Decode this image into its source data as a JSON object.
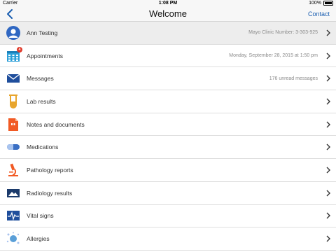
{
  "status_bar": {
    "carrier": "Carrier",
    "time": "1:08 PM",
    "battery": "100%"
  },
  "nav": {
    "title": "Welcome",
    "contact_label": "Contact"
  },
  "profile": {
    "name": "Ann Testing",
    "detail": "Mayo Clinic Number:  3-303-925"
  },
  "menu": [
    {
      "label": "Appointments",
      "detail": "Monday, September 28, 2015 at 1:50 pm",
      "badge": "4"
    },
    {
      "label": "Messages",
      "detail": "176 unread messages"
    },
    {
      "label": "Lab results",
      "detail": ""
    },
    {
      "label": "Notes and documents",
      "detail": ""
    },
    {
      "label": "Medications",
      "detail": ""
    },
    {
      "label": "Pathology reports",
      "detail": ""
    },
    {
      "label": "Radiology results",
      "detail": ""
    },
    {
      "label": "Vital signs",
      "detail": ""
    },
    {
      "label": "Allergies",
      "detail": ""
    }
  ],
  "colors": {
    "accent": "#1a5eb0",
    "badge": "#e03b2b",
    "appointments_icon": "#2b9fd8",
    "messages_icon": "#1f4e9c",
    "lab_icon": "#e8a52c",
    "notes_icon": "#f15a24",
    "medications_icon": "#3a6fc4",
    "pathology_icon": "#f15a24",
    "radiology_icon": "#1b3a6b",
    "vitals_icon": "#1f4e9c",
    "allergies_icon": "#5a9fd8"
  }
}
